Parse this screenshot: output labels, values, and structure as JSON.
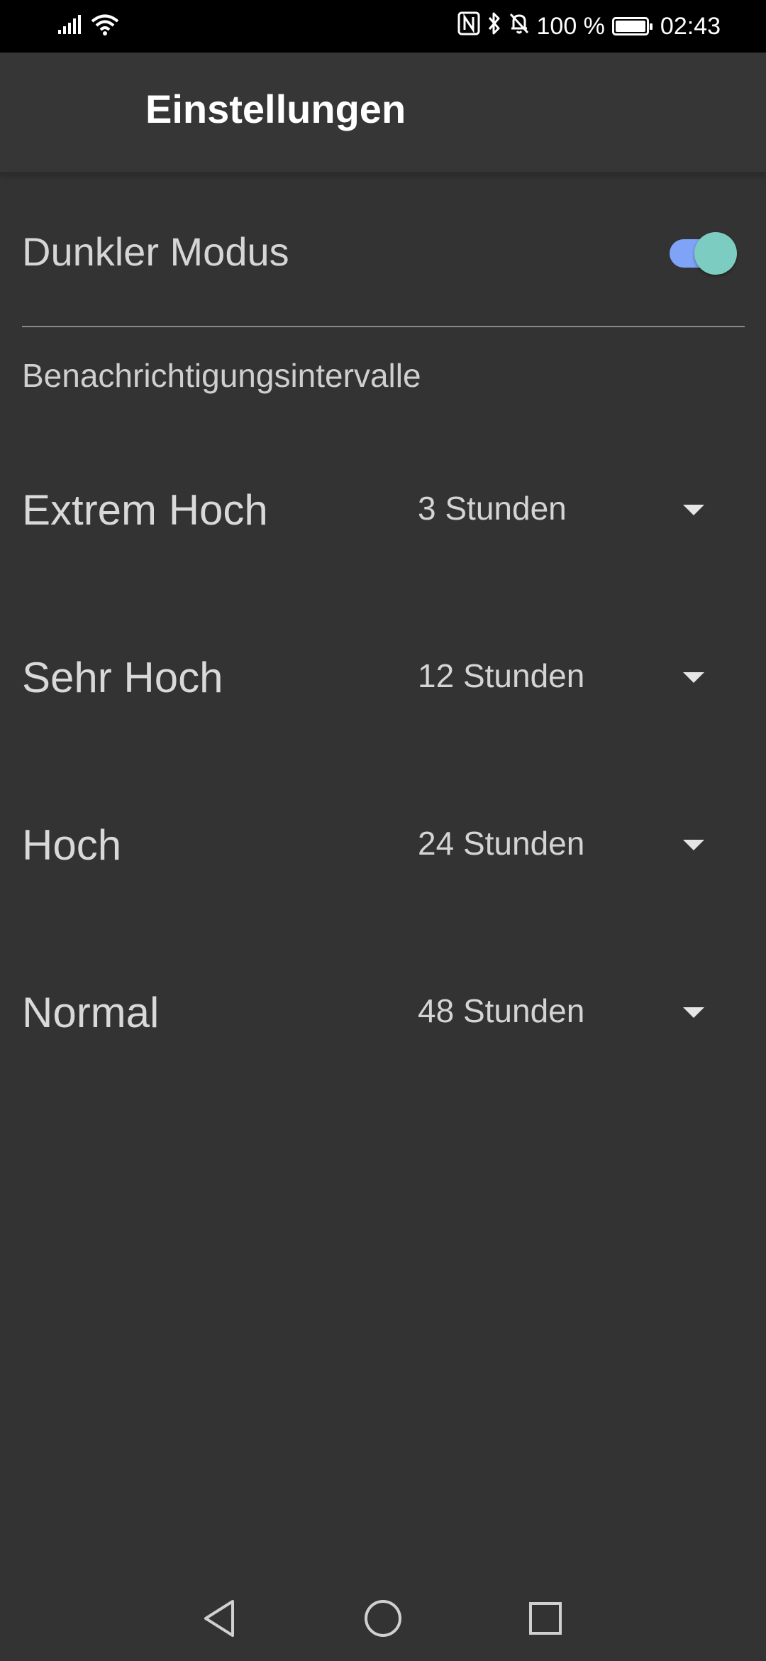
{
  "status_bar": {
    "battery_text": "100 %",
    "time": "02:43",
    "battery_level": 1.0,
    "icons": [
      "signal-icon",
      "wifi-icon",
      "nfc-icon",
      "bluetooth-icon",
      "bell-off-icon",
      "battery-icon"
    ]
  },
  "app_bar": {
    "title": "Einstellungen"
  },
  "settings": {
    "dark_mode": {
      "label": "Dunkler Modus",
      "enabled": true,
      "track_color": "#7ea3f7",
      "thumb_color": "#7dccc2"
    },
    "section_header": "Benachrichtigungsintervalle",
    "intervals": [
      {
        "label": "Extrem Hoch",
        "value": "3 Stunden"
      },
      {
        "label": "Sehr Hoch",
        "value": "12 Stunden"
      },
      {
        "label": "Hoch",
        "value": "24 Stunden"
      },
      {
        "label": "Normal",
        "value": "48 Stunden"
      }
    ]
  },
  "nav_bar": {
    "icons": [
      "back-icon",
      "home-icon",
      "recents-icon"
    ]
  },
  "colors": {
    "background": "#333333",
    "app_bar": "#363636",
    "status_bar": "#000000"
  }
}
